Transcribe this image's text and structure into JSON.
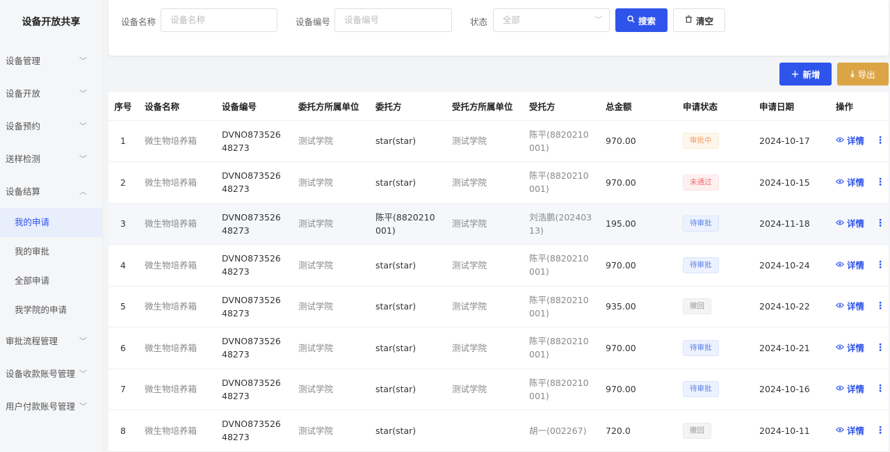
{
  "brand": "设备开放共享",
  "sidebar": {
    "items": [
      {
        "label": "设备管理",
        "chev": "﹀"
      },
      {
        "label": "设备开放",
        "chev": "﹀"
      },
      {
        "label": "设备预约",
        "chev": "﹀"
      },
      {
        "label": "送样检测",
        "chev": "﹀"
      },
      {
        "label": "设备结算",
        "chev": "︿"
      }
    ],
    "sub_items": [
      {
        "label": "我的申请",
        "active": true
      },
      {
        "label": "我的审批"
      },
      {
        "label": "全部申请"
      },
      {
        "label": "我学院的申请"
      }
    ],
    "items_after": [
      {
        "label": "审批流程管理",
        "chev": "﹀"
      },
      {
        "label": "设备收款账号管理",
        "chev": "﹀"
      },
      {
        "label": "用户付款账号管理",
        "chev": "﹀"
      }
    ]
  },
  "filters": {
    "name_label": "设备名称",
    "name_placeholder": "设备名称",
    "code_label": "设备编号",
    "code_placeholder": "设备编号",
    "status_label": "状态",
    "status_value": "全部",
    "search_label": "搜索",
    "clear_label": "清空"
  },
  "actions": {
    "add_label": "新增",
    "export_label": "导出"
  },
  "table": {
    "headers": [
      "序号",
      "设备名称",
      "设备编号",
      "委托方所属单位",
      "委托方",
      "受托方所属单位",
      "受托方",
      "总金额",
      "申请状态",
      "申请日期",
      "操作"
    ],
    "detail_label": "详情",
    "rows": [
      {
        "no": "1",
        "name": "微生物培养箱",
        "code": "DVNO87352648273",
        "client_unit": "测试学院",
        "client": "star(star)",
        "trustee_unit": "测试学院",
        "trustee": "陈平(8820210001)",
        "amount": "970.00",
        "status": "审批中",
        "status_type": "orange",
        "date": "2024-10-17"
      },
      {
        "no": "2",
        "name": "微生物培养箱",
        "code": "DVNO87352648273",
        "client_unit": "测试学院",
        "client": "star(star)",
        "trustee_unit": "测试学院",
        "trustee": "陈平(8820210001)",
        "amount": "970.00",
        "status": "未通过",
        "status_type": "red",
        "date": "2024-10-15"
      },
      {
        "no": "3",
        "name": "微生物培养箱",
        "code": "DVNO87352648273",
        "client_unit": "测试学院",
        "client": "陈平(8820210001)",
        "trustee_unit": "测试学院",
        "trustee": "刘浩鹏(20240313)",
        "amount": "195.00",
        "status": "待审批",
        "status_type": "blue",
        "date": "2024-11-18",
        "hover": true
      },
      {
        "no": "4",
        "name": "微生物培养箱",
        "code": "DVNO87352648273",
        "client_unit": "测试学院",
        "client": "star(star)",
        "trustee_unit": "测试学院",
        "trustee": "陈平(8820210001)",
        "amount": "970.00",
        "status": "待审批",
        "status_type": "blue",
        "date": "2024-10-24"
      },
      {
        "no": "5",
        "name": "微生物培养箱",
        "code": "DVNO87352648273",
        "client_unit": "测试学院",
        "client": "star(star)",
        "trustee_unit": "测试学院",
        "trustee": "陈平(8820210001)",
        "amount": "935.00",
        "status": "撤回",
        "status_type": "gray",
        "date": "2024-10-22"
      },
      {
        "no": "6",
        "name": "微生物培养箱",
        "code": "DVNO87352648273",
        "client_unit": "测试学院",
        "client": "star(star)",
        "trustee_unit": "测试学院",
        "trustee": "陈平(8820210001)",
        "amount": "970.00",
        "status": "待审批",
        "status_type": "blue",
        "date": "2024-10-21"
      },
      {
        "no": "7",
        "name": "微生物培养箱",
        "code": "DVNO87352648273",
        "client_unit": "测试学院",
        "client": "star(star)",
        "trustee_unit": "测试学院",
        "trustee": "陈平(8820210001)",
        "amount": "970.00",
        "status": "待审批",
        "status_type": "blue",
        "date": "2024-10-16"
      },
      {
        "no": "8",
        "name": "微生物培养箱",
        "code": "DVNO87352648273",
        "client_unit": "测试学院",
        "client": "star(star)",
        "trustee_unit": "",
        "trustee": "胡一(002267)",
        "amount": "720.0",
        "status": "撤回",
        "status_type": "gray",
        "date": "2024-10-11"
      }
    ]
  },
  "colors": {
    "primary": "#2f54eb",
    "warning": "#dba545",
    "sidebar_active_bg": "#e8eefc"
  }
}
